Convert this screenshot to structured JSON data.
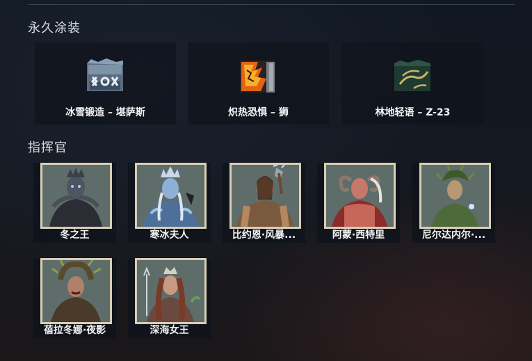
{
  "sections": {
    "skins_title": "永久涂装",
    "commanders_title": "指挥官"
  },
  "skins": [
    {
      "label": "冰雪锻造 – 堪萨斯",
      "icon": "frost-forged-skin-icon"
    },
    {
      "label": "炽热恐惧 – 狮",
      "icon": "blazing-dread-skin-icon"
    },
    {
      "label": "林地轻语 – Z-23",
      "icon": "woodland-whisper-skin-icon"
    }
  ],
  "commanders": [
    {
      "label": "冬之王",
      "icon": "winter-king-portrait"
    },
    {
      "label": "寒冰夫人",
      "icon": "ice-lady-portrait"
    },
    {
      "label": "比约恩·风暴...",
      "icon": "bjorn-portrait"
    },
    {
      "label": "阿蒙·西特里",
      "icon": "amon-sitri-portrait"
    },
    {
      "label": "尼尔达内尔·...",
      "icon": "nyrdanel-portrait"
    },
    {
      "label": "蓓拉冬娜·夜影",
      "icon": "belladonna-portrait"
    },
    {
      "label": "深海女王",
      "icon": "sea-queen-portrait"
    }
  ],
  "colors": {
    "portrait_frame": "#d9cdb6",
    "portrait_bg": "#5e6b68"
  }
}
